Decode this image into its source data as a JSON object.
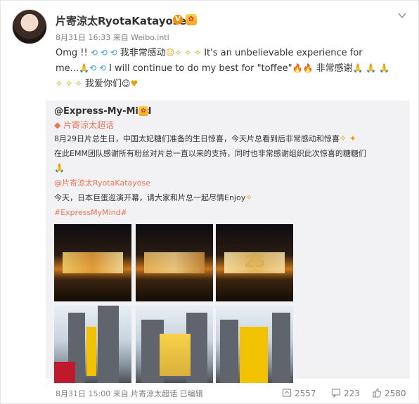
{
  "author": {
    "name": "片寄涼太RyotaKatayose",
    "verified_badge": "V",
    "meta": "8月31日 16:33 来自 Weibo.intl"
  },
  "post": {
    "line1_a": "Omg !! ",
    "line1_b": " 我非常感动",
    "line1_c": " It's an unbelievable experience for",
    "line2_a": "me...",
    "line2_b": " I will continue to do my best for \"toffee\"",
    "line2_c": " 非常感谢",
    "line3_a": " 我爱你们"
  },
  "repost": {
    "user": "@Express-My-Mind",
    "topic": "片寄涼太超话",
    "line1": "8月29日片总生日，中国太妃糖们准备的生日惊喜，今天片总看到后非常感动和惊喜",
    "line2": "在此EMM团队感谢所有粉丝对片总一直以来的支持，同时也非常感谢组织此次惊喜的糖糖们",
    "mention": "@片寄涼太RyotaKatayose",
    "line5": "今天，日本巨蛋巡演开幕，请大家和片总一起尽情Enjoy",
    "hashtag": "#ExpressMyMind#",
    "billboard_number": "25"
  },
  "footer": {
    "meta_a": "8月31日 15:00 来自 ",
    "meta_topic": "片寄涼太超话",
    "meta_b": " 已编辑",
    "reposts": "2557",
    "comments": "223",
    "likes": "2580"
  },
  "colors": {
    "link": "#eb7350",
    "repost_bg": "#f2f2f5",
    "meta": "#808080"
  },
  "icons": [
    "close-arrow-icon",
    "repost-icon",
    "comment-icon",
    "like-icon"
  ]
}
